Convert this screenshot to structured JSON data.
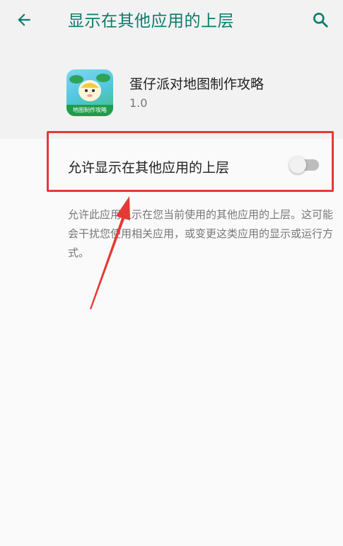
{
  "header": {
    "title": "显示在其他应用的上层",
    "back_icon": "arrow-left-icon",
    "search_icon": "search-icon"
  },
  "app": {
    "name": "蛋仔派对地图制作攻略",
    "version": "1.0",
    "icon_caption": "地图制作攻略"
  },
  "setting": {
    "label": "允许显示在其他应用的上层",
    "toggle_on": false
  },
  "description": "允许此应用显示在您当前使用的其他应用的上层。这可能会干扰您使用相关应用，或变更这类应用的显示或运行方式。",
  "colors": {
    "accent": "#0b7b6b",
    "highlight": "#e53935"
  }
}
